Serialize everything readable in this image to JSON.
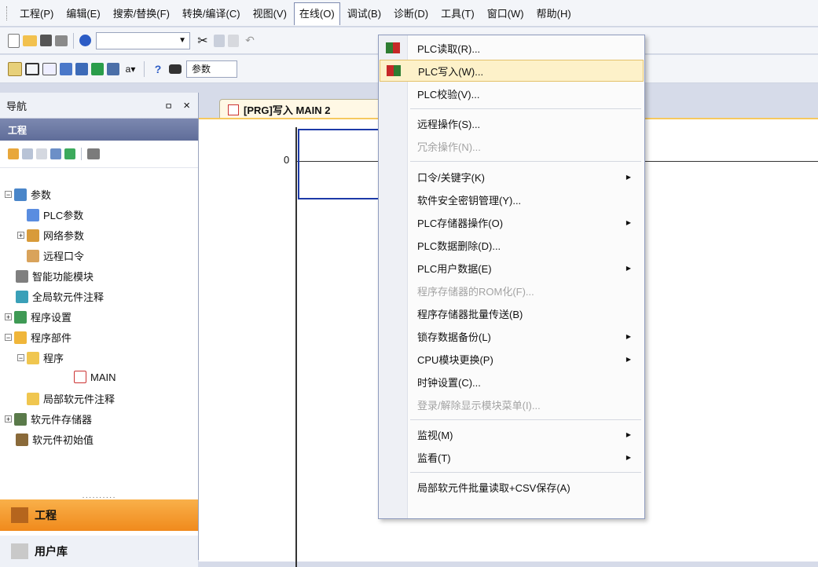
{
  "menubar": {
    "items": [
      "工程(P)",
      "编辑(E)",
      "搜索/替换(F)",
      "转换/编译(C)",
      "视图(V)",
      "在线(O)",
      "调试(B)",
      "诊断(D)",
      "工具(T)",
      "窗口(W)",
      "帮助(H)"
    ]
  },
  "toolbar2": {
    "combo_text": "参数"
  },
  "nav": {
    "title": "导航",
    "pin": "ㅁ",
    "close": "×",
    "section": "工程",
    "tree": [
      {
        "label": "参数"
      },
      {
        "label": "PLC参数"
      },
      {
        "label": "网络参数"
      },
      {
        "label": "远程口令"
      },
      {
        "label": "智能功能模块"
      },
      {
        "label": "全局软元件注释"
      },
      {
        "label": "程序设置"
      },
      {
        "label": "程序部件"
      },
      {
        "label": "程序"
      },
      {
        "label": "MAIN"
      },
      {
        "label": "局部软元件注释"
      },
      {
        "label": "软元件存储器"
      },
      {
        "label": "软元件初始值"
      }
    ],
    "splitter": "··········",
    "btn_project": "工程",
    "btn_user": "用户库"
  },
  "editor": {
    "tab_label": "[PRG]写入 MAIN 2",
    "rung_number": "0"
  },
  "dropdown": {
    "items": [
      {
        "label": "PLC读取(R)...",
        "disabled": false
      },
      {
        "label": "PLC写入(W)...",
        "disabled": false
      },
      {
        "label": "PLC校验(V)...",
        "disabled": false
      },
      {
        "label": "远程操作(S)...",
        "disabled": false
      },
      {
        "label": "冗余操作(N)...",
        "disabled": true
      },
      {
        "label": "口令/关键字(K)",
        "disabled": false
      },
      {
        "label": "软件安全密钥管理(Y)...",
        "disabled": false
      },
      {
        "label": "PLC存储器操作(O)",
        "disabled": false
      },
      {
        "label": "PLC数据删除(D)...",
        "disabled": false
      },
      {
        "label": "PLC用户数据(E)",
        "disabled": false
      },
      {
        "label": "程序存储器的ROM化(F)...",
        "disabled": true
      },
      {
        "label": "程序存储器批量传送(B)",
        "disabled": false
      },
      {
        "label": "锁存数据备份(L)",
        "disabled": false
      },
      {
        "label": "CPU模块更换(P)",
        "disabled": false
      },
      {
        "label": "时钟设置(C)...",
        "disabled": false
      },
      {
        "label": "登录/解除显示模块菜单(I)...",
        "disabled": true
      },
      {
        "label": "监视(M)",
        "disabled": false
      },
      {
        "label": "监看(T)",
        "disabled": false
      },
      {
        "label": "局部软元件批量读取+CSV保存(A)",
        "disabled": false
      }
    ]
  }
}
